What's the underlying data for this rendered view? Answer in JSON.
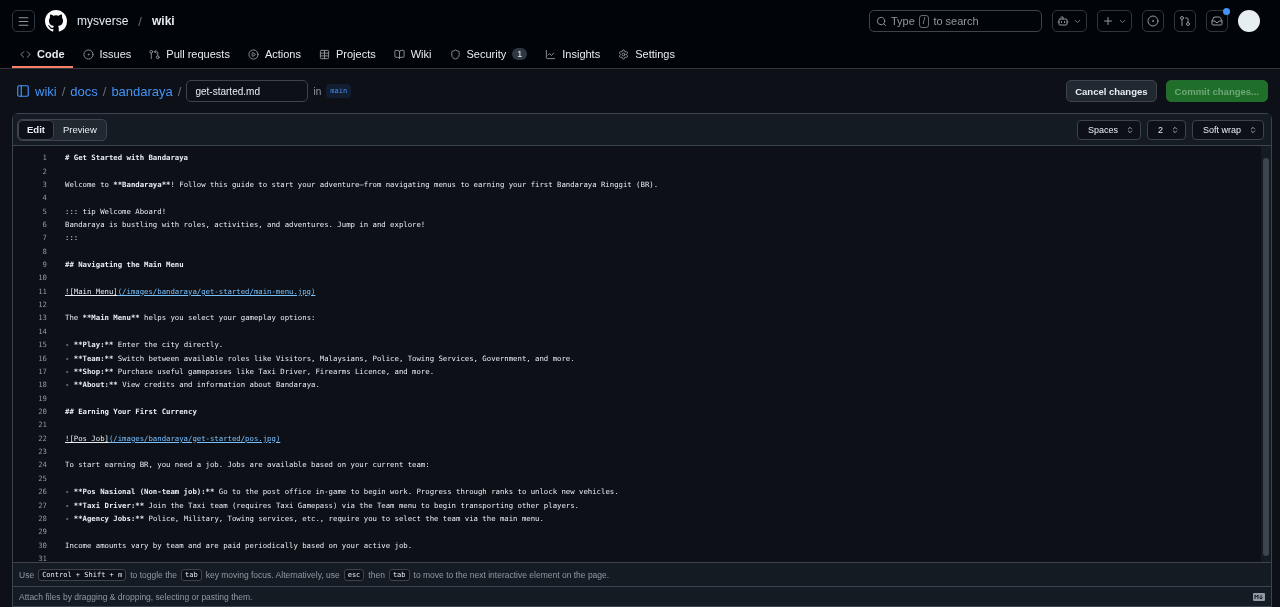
{
  "header": {
    "owner": "mysverse",
    "separator": "/",
    "repo": "wiki",
    "search_placeholder_parts": [
      "Type",
      "/",
      "to search"
    ],
    "notification_dot": true
  },
  "repo_tabs": [
    {
      "label": "Code",
      "selected": true
    },
    {
      "label": "Issues",
      "selected": false
    },
    {
      "label": "Pull requests",
      "selected": false
    },
    {
      "label": "Actions",
      "selected": false
    },
    {
      "label": "Projects",
      "selected": false
    },
    {
      "label": "Wiki",
      "selected": false
    },
    {
      "label": "Security",
      "selected": false,
      "count": "1"
    },
    {
      "label": "Insights",
      "selected": false
    },
    {
      "label": "Settings",
      "selected": false
    }
  ],
  "breadcrumb": {
    "parts": [
      {
        "label": "wiki",
        "separator": "/"
      },
      {
        "label": "docs",
        "separator": "/"
      },
      {
        "label": "bandaraya",
        "separator": "/"
      }
    ],
    "filename": "get-started.md",
    "in_label": "in",
    "branch": "main"
  },
  "actions": {
    "cancel": "Cancel changes",
    "commit": "Commit changes...",
    "commit_disabled": true
  },
  "editor_tabs": [
    {
      "label": "Edit",
      "selected": true
    },
    {
      "label": "Preview",
      "selected": false
    }
  ],
  "editor_settings": [
    {
      "label": "Spaces"
    },
    {
      "label": "2"
    },
    {
      "label": "Soft wrap"
    }
  ],
  "lines": [
    {
      "number": "1",
      "segments": [
        {
          "kind": "bold",
          "text": "# Get Started with Bandaraya"
        }
      ]
    },
    {
      "number": "2"
    },
    {
      "number": "3",
      "segments": [
        {
          "kind": "plain",
          "text": "Welcome to "
        },
        {
          "kind": "bold",
          "text": "**Bandaraya**"
        },
        {
          "kind": "plain",
          "text": "! Follow this guide to start your adventure—from navigating menus to earning your first Bandaraya Ringgit (BR)."
        }
      ]
    },
    {
      "number": "4"
    },
    {
      "number": "5",
      "segments": [
        {
          "kind": "plain",
          "text": "::: tip Welcome Aboard!"
        }
      ]
    },
    {
      "number": "6",
      "segments": [
        {
          "kind": "plain",
          "text": "Bandaraya is bustling with roles, activities, and adventures. Jump in and explore!"
        }
      ]
    },
    {
      "number": "7",
      "segments": [
        {
          "kind": "plain",
          "text": ":::"
        }
      ]
    },
    {
      "number": "8"
    },
    {
      "number": "9",
      "segments": [
        {
          "kind": "bold",
          "text": "## Navigating the Main Menu"
        }
      ]
    },
    {
      "number": "10"
    },
    {
      "number": "11",
      "segments": [
        {
          "kind": "alt",
          "text": "![Main Menu]"
        },
        {
          "kind": "link",
          "text": "(/images/bandaraya/get-started/main-menu.jpg)"
        }
      ]
    },
    {
      "number": "12"
    },
    {
      "number": "13",
      "segments": [
        {
          "kind": "plain",
          "text": "The "
        },
        {
          "kind": "bold",
          "text": "**Main Menu**"
        },
        {
          "kind": "plain",
          "text": " helps you select your gameplay options:"
        }
      ]
    },
    {
      "number": "14"
    },
    {
      "number": "15",
      "segments": [
        {
          "kind": "plain",
          "text": "- "
        },
        {
          "kind": "bold",
          "text": "**Play:**"
        },
        {
          "kind": "plain",
          "text": " Enter the city directly."
        }
      ]
    },
    {
      "number": "16",
      "segments": [
        {
          "kind": "plain",
          "text": "- "
        },
        {
          "kind": "bold",
          "text": "**Team:**"
        },
        {
          "kind": "plain",
          "text": " Switch between available roles like Visitors, Malaysians, Police, Towing Services, Government, and more."
        }
      ]
    },
    {
      "number": "17",
      "segments": [
        {
          "kind": "plain",
          "text": "- "
        },
        {
          "kind": "bold",
          "text": "**Shop:**"
        },
        {
          "kind": "plain",
          "text": " Purchase useful gamepasses like Taxi Driver, Firearms Licence, and more."
        }
      ]
    },
    {
      "number": "18",
      "segments": [
        {
          "kind": "plain",
          "text": "- "
        },
        {
          "kind": "bold",
          "text": "**About:**"
        },
        {
          "kind": "plain",
          "text": " View credits and information about Bandaraya."
        }
      ]
    },
    {
      "number": "19"
    },
    {
      "number": "20",
      "segments": [
        {
          "kind": "bold",
          "text": "## Earning Your First Currency"
        }
      ]
    },
    {
      "number": "21"
    },
    {
      "number": "22",
      "segments": [
        {
          "kind": "alt",
          "text": "![Pos Job]"
        },
        {
          "kind": "link",
          "text": "(/images/bandaraya/get-started/pos.jpg)"
        }
      ]
    },
    {
      "number": "23"
    },
    {
      "number": "24",
      "segments": [
        {
          "kind": "plain",
          "text": "To start earning BR, you need a job. Jobs are available based on your current team:"
        }
      ]
    },
    {
      "number": "25"
    },
    {
      "number": "26",
      "segments": [
        {
          "kind": "plain",
          "text": "- "
        },
        {
          "kind": "bold",
          "text": "**Pos Nasional (Non-team job):**"
        },
        {
          "kind": "plain",
          "text": " Go to the post office in-game to begin work. Progress through ranks to unlock new vehicles."
        }
      ]
    },
    {
      "number": "27",
      "segments": [
        {
          "kind": "plain",
          "text": "- "
        },
        {
          "kind": "bold",
          "text": "**Taxi Driver:**"
        },
        {
          "kind": "plain",
          "text": " Join the Taxi team (requires Taxi Gamepass) via the Team menu to begin transporting other players."
        }
      ]
    },
    {
      "number": "28",
      "segments": [
        {
          "kind": "plain",
          "text": "- "
        },
        {
          "kind": "bold",
          "text": "**Agency Jobs:**"
        },
        {
          "kind": "plain",
          "text": " Police, Military, Towing services, etc., require you to select the team via the main menu."
        }
      ]
    },
    {
      "number": "29"
    },
    {
      "number": "30",
      "segments": [
        {
          "kind": "plain",
          "text": "Income amounts vary by team and are paid periodically based on your active job."
        }
      ]
    },
    {
      "number": "31"
    }
  ],
  "help_bar": [
    {
      "kind": "text",
      "text": "Use"
    },
    {
      "kind": "key",
      "text": "Control + Shift + m"
    },
    {
      "kind": "text",
      "text": "to toggle the"
    },
    {
      "kind": "key",
      "text": "tab"
    },
    {
      "kind": "text",
      "text": "key moving focus. Alternatively, use"
    },
    {
      "kind": "key",
      "text": "esc"
    },
    {
      "kind": "text",
      "text": "then"
    },
    {
      "kind": "key",
      "text": "tab"
    },
    {
      "kind": "text",
      "text": "to move to the next interactive element on the page."
    }
  ],
  "attach_hint": "Attach files by dragging & dropping, selecting or pasting them."
}
